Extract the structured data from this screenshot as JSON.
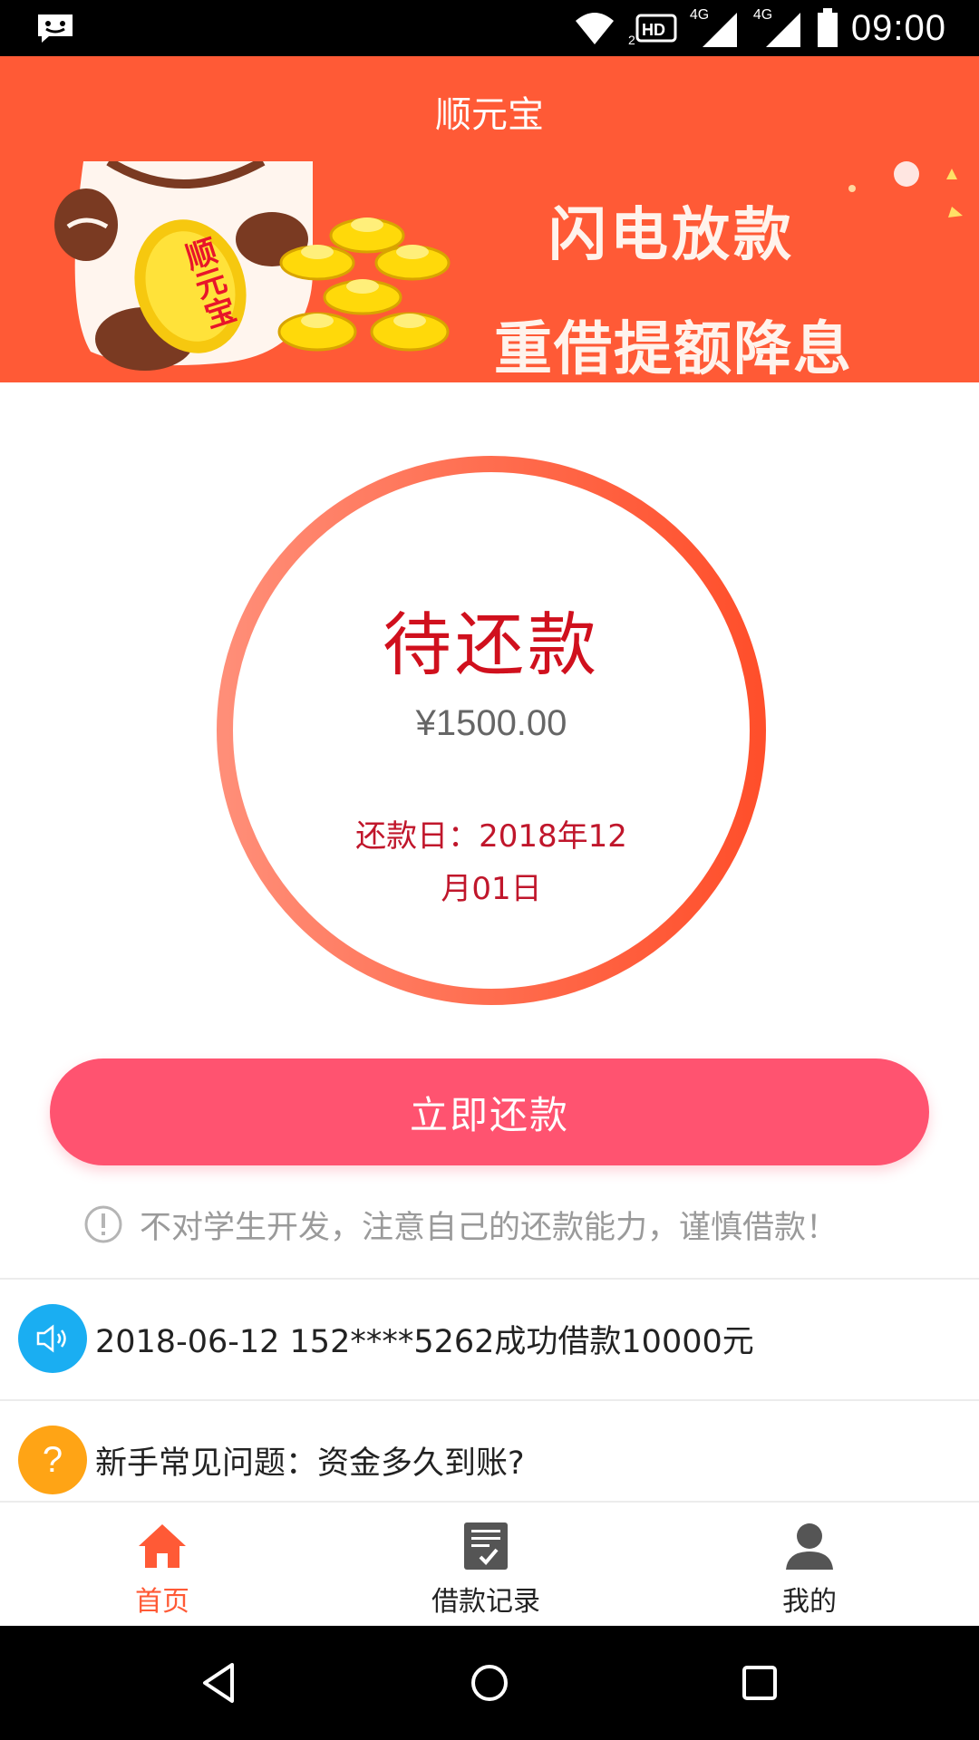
{
  "status_bar": {
    "time": "09:00",
    "network_1": "4G",
    "network_2": "4G",
    "icons": [
      "message-icon",
      "wifi-icon",
      "hd-icon",
      "signal-icon",
      "signal-icon",
      "battery-icon"
    ]
  },
  "header": {
    "title": "顺元宝"
  },
  "banner": {
    "line1": "闪电放款",
    "line2": "重借提额降息",
    "coin_text": "顺元宝"
  },
  "loan": {
    "status": "待还款",
    "amount": "¥1500.00",
    "due_date": "还款日：2018年12月01日"
  },
  "repay_button": {
    "label": "立即还款"
  },
  "notice": {
    "text": "不对学生开发，注意自己的还款能力，谨慎借款！"
  },
  "list": [
    {
      "icon": "speaker-icon",
      "text": "2018-06-12 152****5262成功借款10000元"
    },
    {
      "icon": "question-icon",
      "text": "新手常见问题：资金多久到账?"
    }
  ],
  "tabs": [
    {
      "label": "首页",
      "icon": "home-icon",
      "active": true
    },
    {
      "label": "借款记录",
      "icon": "records-icon",
      "active": false
    },
    {
      "label": "我的",
      "icon": "user-icon",
      "active": false
    }
  ],
  "colors": {
    "brand": "#ff5a36",
    "button": "#ff5370",
    "status_text": "#d0101d",
    "speaker_icon_bg": "#1aaef2",
    "question_icon_bg": "#ffa415"
  }
}
